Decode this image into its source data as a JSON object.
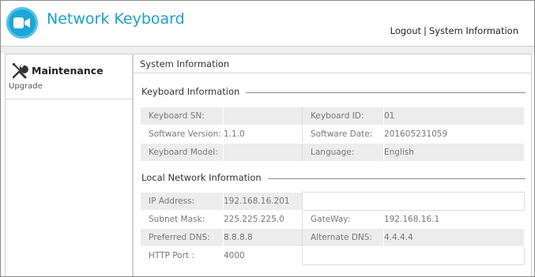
{
  "header": {
    "app_title": "Network Keyboard",
    "logout_label": "Logout",
    "separator": "|",
    "system_info_label": "System Information",
    "brand_color": "#1aa7d8"
  },
  "sidebar": {
    "section_label": "Maintenance",
    "section_icon": "tools-icon",
    "items": [
      {
        "label": "Upgrade"
      }
    ]
  },
  "main": {
    "title": "System Information",
    "keyboard_section": {
      "title": "Keyboard Information",
      "rows": [
        {
          "label1": "Keyboard SN:",
          "value1": "",
          "label2": "Keyboard ID:",
          "value2": "01"
        },
        {
          "label1": "Software Version:",
          "value1": "1.1.0",
          "label2": "Software Date:",
          "value2": "201605231059"
        },
        {
          "label1": "Keyboard Model:",
          "value1": "",
          "label2": "Language:",
          "value2": "English"
        }
      ]
    },
    "network_section": {
      "title": "Local Network Information",
      "rows": [
        {
          "label1": "IP Address:",
          "value1": "192.168.16.201",
          "label2": "",
          "value2": ""
        },
        {
          "label1": "Subnet Mask:",
          "value1": "225.225.225.0",
          "label2": "GateWay:",
          "value2": "192.168.16.1"
        },
        {
          "label1": "Preferred DNS:",
          "value1": "8.8.8.8",
          "label2": "Alternate DNS:",
          "value2": "4.4.4.4"
        },
        {
          "label1": "HTTP Port :",
          "value1": "4000",
          "label2": "",
          "value2": ""
        }
      ]
    }
  }
}
